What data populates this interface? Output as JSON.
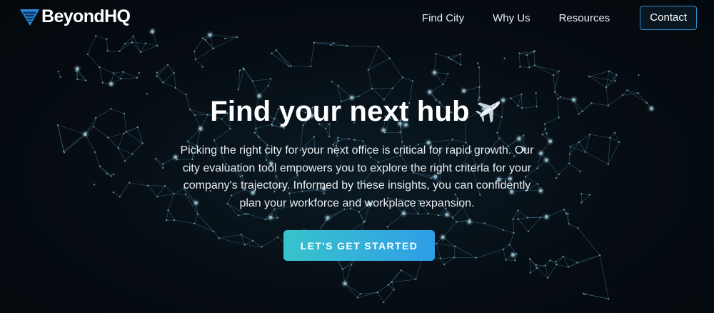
{
  "brand": {
    "name": "BeyondHQ",
    "logo_icon": "beyondhq-logo-icon"
  },
  "nav": {
    "links": [
      "Find City",
      "Why Us",
      "Resources"
    ],
    "contact_label": "Contact"
  },
  "hero": {
    "title": "Find your next hub",
    "title_icon": "airplane-icon",
    "description": "Picking the right city for your next office is critical for rapid growth. Our city evaluation tool empowers you to explore the right criteria for your company's trajectory. Informed by these insights, you can confidently plan your workforce and workplace expansion.",
    "cta_label": "LET'S GET STARTED"
  },
  "colors": {
    "background": "#050b10",
    "network_line": "#4f8ca8",
    "node": "#9fc6d6",
    "cta_start": "#38c3cc",
    "cta_end": "#2f9ee6",
    "contact_border": "#2f8fd3"
  }
}
